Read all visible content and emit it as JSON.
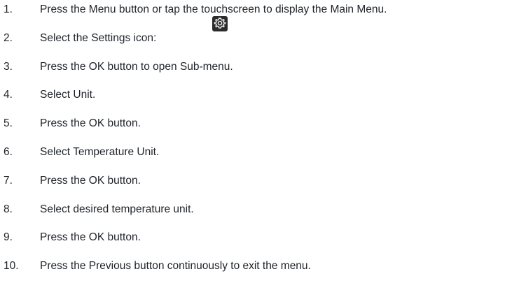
{
  "steps": [
    {
      "num": "1.",
      "text": "Press the Menu button or tap the touchscreen to display the Main Menu."
    },
    {
      "num": "2.",
      "text": "Select the Settings icon:"
    },
    {
      "num": "3.",
      "text": "Press the OK button to open Sub-menu."
    },
    {
      "num": "4.",
      "text": "Select Unit."
    },
    {
      "num": "5.",
      "text": "Press the OK button."
    },
    {
      "num": "6.",
      "text": "Select Temperature Unit."
    },
    {
      "num": "7.",
      "text": "Press the OK button."
    },
    {
      "num": "8.",
      "text": "Select desired temperature unit."
    },
    {
      "num": "9.",
      "text": "Press the OK button."
    },
    {
      "num": "10.",
      "text": "Press the Previous button continuously to exit the menu."
    }
  ],
  "settings_icon": {
    "name": "gear-icon",
    "color": "#2b2b2b"
  }
}
